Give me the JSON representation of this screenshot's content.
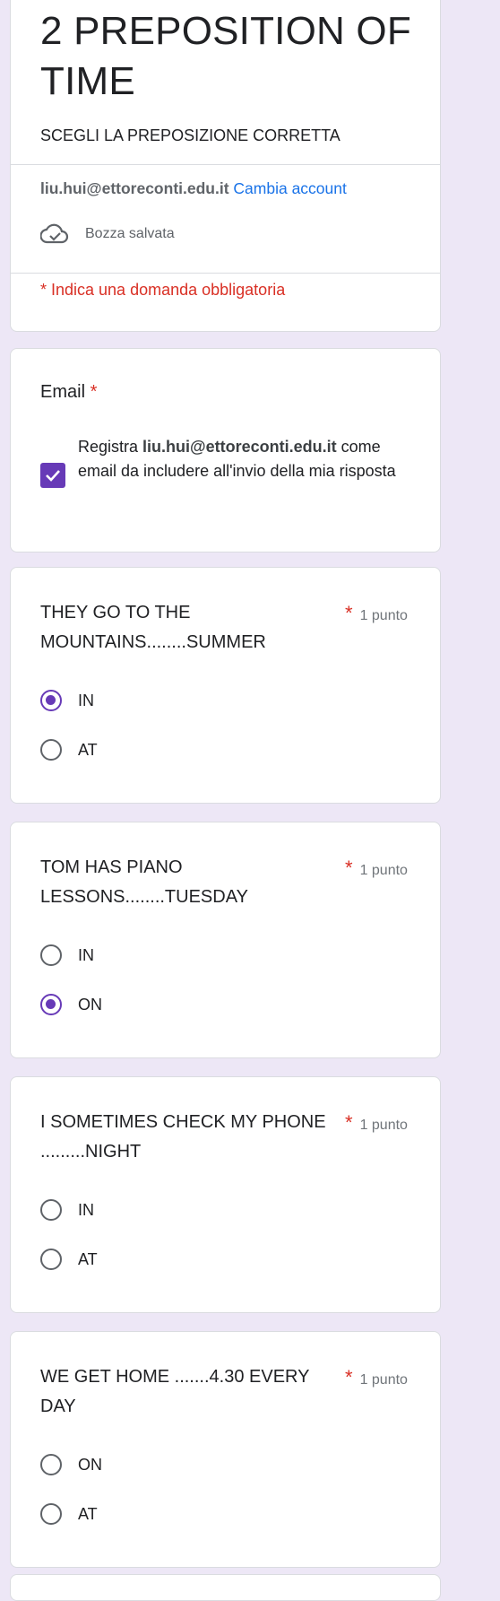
{
  "form": {
    "title_line1": "2 PREPOSITION OF",
    "title_line2": "TIME",
    "description": "SCEGLI LA PREPOSIZIONE CORRETTA",
    "account_email": "liu.hui@ettoreconti.edu.it",
    "switch_account": "Cambia account",
    "draft_status": "Bozza salvata",
    "required_note": "* Indica una domanda obbligatoria"
  },
  "email_question": {
    "label": "Email",
    "required_mark": "*",
    "checkbox_prefix": "Registra",
    "checkbox_email": "liu.hui@ettoreconti.edu.it",
    "checkbox_suffix": "come email da includere all'invio della mia risposta",
    "checked": true
  },
  "questions": [
    {
      "text": "THEY GO TO THE MOUNTAINS........SUMMER",
      "required_mark": "*",
      "points": "1 punto",
      "options": [
        {
          "label": "IN",
          "selected": true
        },
        {
          "label": "AT",
          "selected": false
        }
      ]
    },
    {
      "text": "TOM HAS PIANO LESSONS........TUESDAY",
      "required_mark": "*",
      "points": "1 punto",
      "options": [
        {
          "label": "IN",
          "selected": false
        },
        {
          "label": "ON",
          "selected": true
        }
      ]
    },
    {
      "text": "I SOMETIMES CHECK MY PHONE .........NIGHT",
      "required_mark": "*",
      "points": "1 punto",
      "options": [
        {
          "label": "IN",
          "selected": false
        },
        {
          "label": "AT",
          "selected": false
        }
      ]
    },
    {
      "text": "WE GET HOME .......4.30 EVERY DAY",
      "required_mark": "*",
      "points": "1 punto",
      "options": [
        {
          "label": "ON",
          "selected": false
        },
        {
          "label": "AT",
          "selected": false
        }
      ]
    }
  ],
  "colors": {
    "accent": "#673ab7",
    "required": "#d93025",
    "link": "#1a73e8",
    "background": "#ede7f6"
  }
}
